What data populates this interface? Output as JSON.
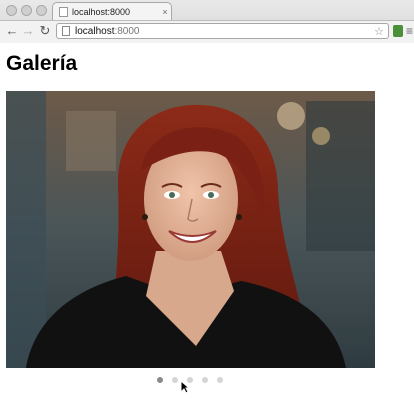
{
  "browser": {
    "tab_title": "localhost:8000",
    "tab_close": "×",
    "url_host": "localhost",
    "url_port": ":8000",
    "back_icon": "back-arrow-icon",
    "forward_icon": "forward-arrow-icon",
    "reload_icon": "reload-icon",
    "bookmark_icon": "star-icon"
  },
  "page": {
    "title": "Galería"
  },
  "gallery": {
    "slide_count": 5,
    "active_index": 0,
    "colors": {
      "hair": "#7a2014",
      "skin": "#e2b49a",
      "shirt": "#111111",
      "background": "#3a4a50"
    }
  }
}
